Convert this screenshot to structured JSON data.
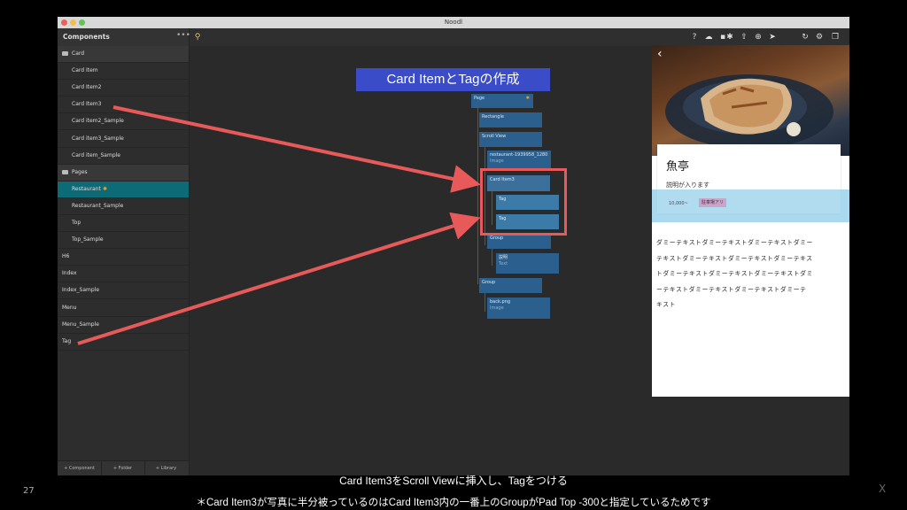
{
  "window": {
    "title": "Noodl"
  },
  "sidebar": {
    "title": "Components",
    "more": "•••",
    "rows": [
      {
        "label": "Card",
        "kind": "folder"
      },
      {
        "label": "Card Item",
        "kind": "child"
      },
      {
        "label": "Card Item2",
        "kind": "child"
      },
      {
        "label": "Card Item3",
        "kind": "child"
      },
      {
        "label": "Card item2_Sample",
        "kind": "child"
      },
      {
        "label": "Card item3_Sample",
        "kind": "child"
      },
      {
        "label": "Card item_Sample",
        "kind": "child"
      },
      {
        "label": "Pages",
        "kind": "folder"
      },
      {
        "label": "Restaurant",
        "kind": "child",
        "selected": true,
        "star": "✱"
      },
      {
        "label": "Restaurant_Sample",
        "kind": "child"
      },
      {
        "label": "Top",
        "kind": "child"
      },
      {
        "label": "Top_Sample",
        "kind": "child"
      },
      {
        "label": "H6",
        "kind": "top"
      },
      {
        "label": "Index",
        "kind": "top"
      },
      {
        "label": "Index_Sample",
        "kind": "top"
      },
      {
        "label": "Menu",
        "kind": "top"
      },
      {
        "label": "Menu_Sample",
        "kind": "top"
      },
      {
        "label": "Tag",
        "kind": "top"
      }
    ],
    "footer": [
      "+ Component",
      "+ Folder",
      "+ Library"
    ]
  },
  "tree": {
    "page": "Page",
    "page_star": "✱",
    "rectangle": "Rectangle",
    "scroll_view": "Scroll View",
    "image_node": "restaurant-1939958_1280",
    "image_node_sub": "Image",
    "card_item3": "Card Item3",
    "tag1": "Tag",
    "tag2": "Tag",
    "group1": "Group",
    "setsumei": "説明",
    "setsumei_sub": "Text",
    "group2": "Group",
    "back": "back.png",
    "back_sub": "Image"
  },
  "preview": {
    "back_icon": "‹",
    "title": "魚亭",
    "description": "説明が入ります",
    "price_tag": "10,000~",
    "parking_tag": "駐車場アリ",
    "lorem": "ダミーテキストダミーテキストダミーテキストダミー\nテキストダミーテキストダミーテキストダミーテキス\nトダミーテキストダミーテキストダミーテキストダミ\nーテキストダミーテキストダミーテキストダミーテ\nキスト"
  },
  "callout": "Card ItemとTagの作成",
  "captions": {
    "line1": "Card Item3をScroll Viewに挿入し、Tagをつける",
    "line2": "＊Card Item3が写真に半分被っているのはCard Item3内の一番上のGroupがPad Top -300と指定しているためです"
  },
  "slide": {
    "page_number": "27",
    "close": "X"
  },
  "colors": {
    "accent": "#3a4cc7",
    "annotation": "#e85a5a",
    "selected": "#0d6b78",
    "node": "#2b5f8e"
  }
}
